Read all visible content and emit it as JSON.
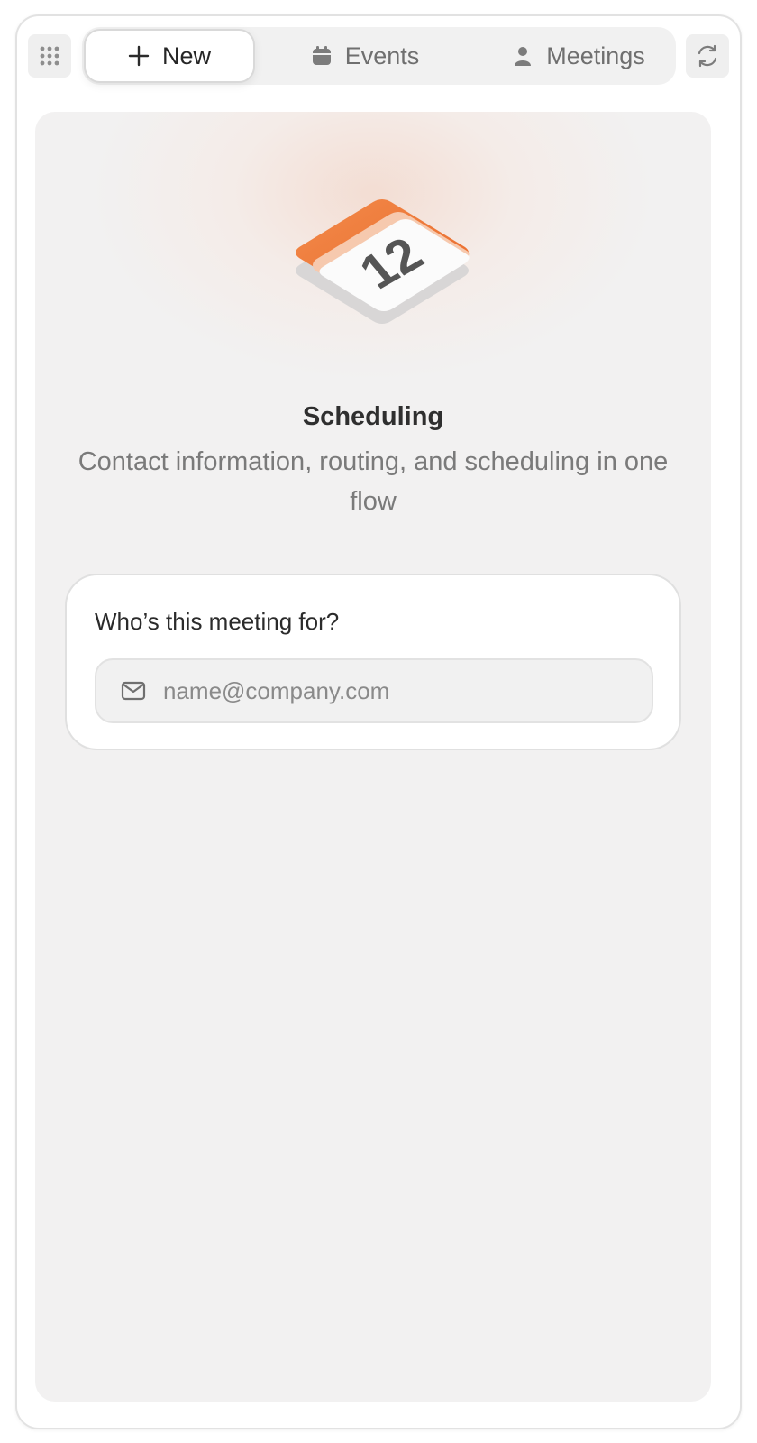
{
  "toolbar": {
    "apps_icon": "grid-dots-icon",
    "refresh_icon": "refresh-icon"
  },
  "tabs": [
    {
      "label": "New",
      "icon": "plus-icon",
      "active": true
    },
    {
      "label": "Events",
      "icon": "calendar-icon",
      "active": false
    },
    {
      "label": "Meetings",
      "icon": "person-icon",
      "active": false
    }
  ],
  "hero": {
    "icon": "calendar-day-icon",
    "day": "12",
    "accent_color": "#F07A3A",
    "title": "Scheduling",
    "subtitle": "Contact information, routing, and scheduling in one flow"
  },
  "form": {
    "question": "Who’s this meeting for?",
    "email_icon": "mail-icon",
    "email_value": "",
    "email_placeholder": "name@company.com"
  }
}
